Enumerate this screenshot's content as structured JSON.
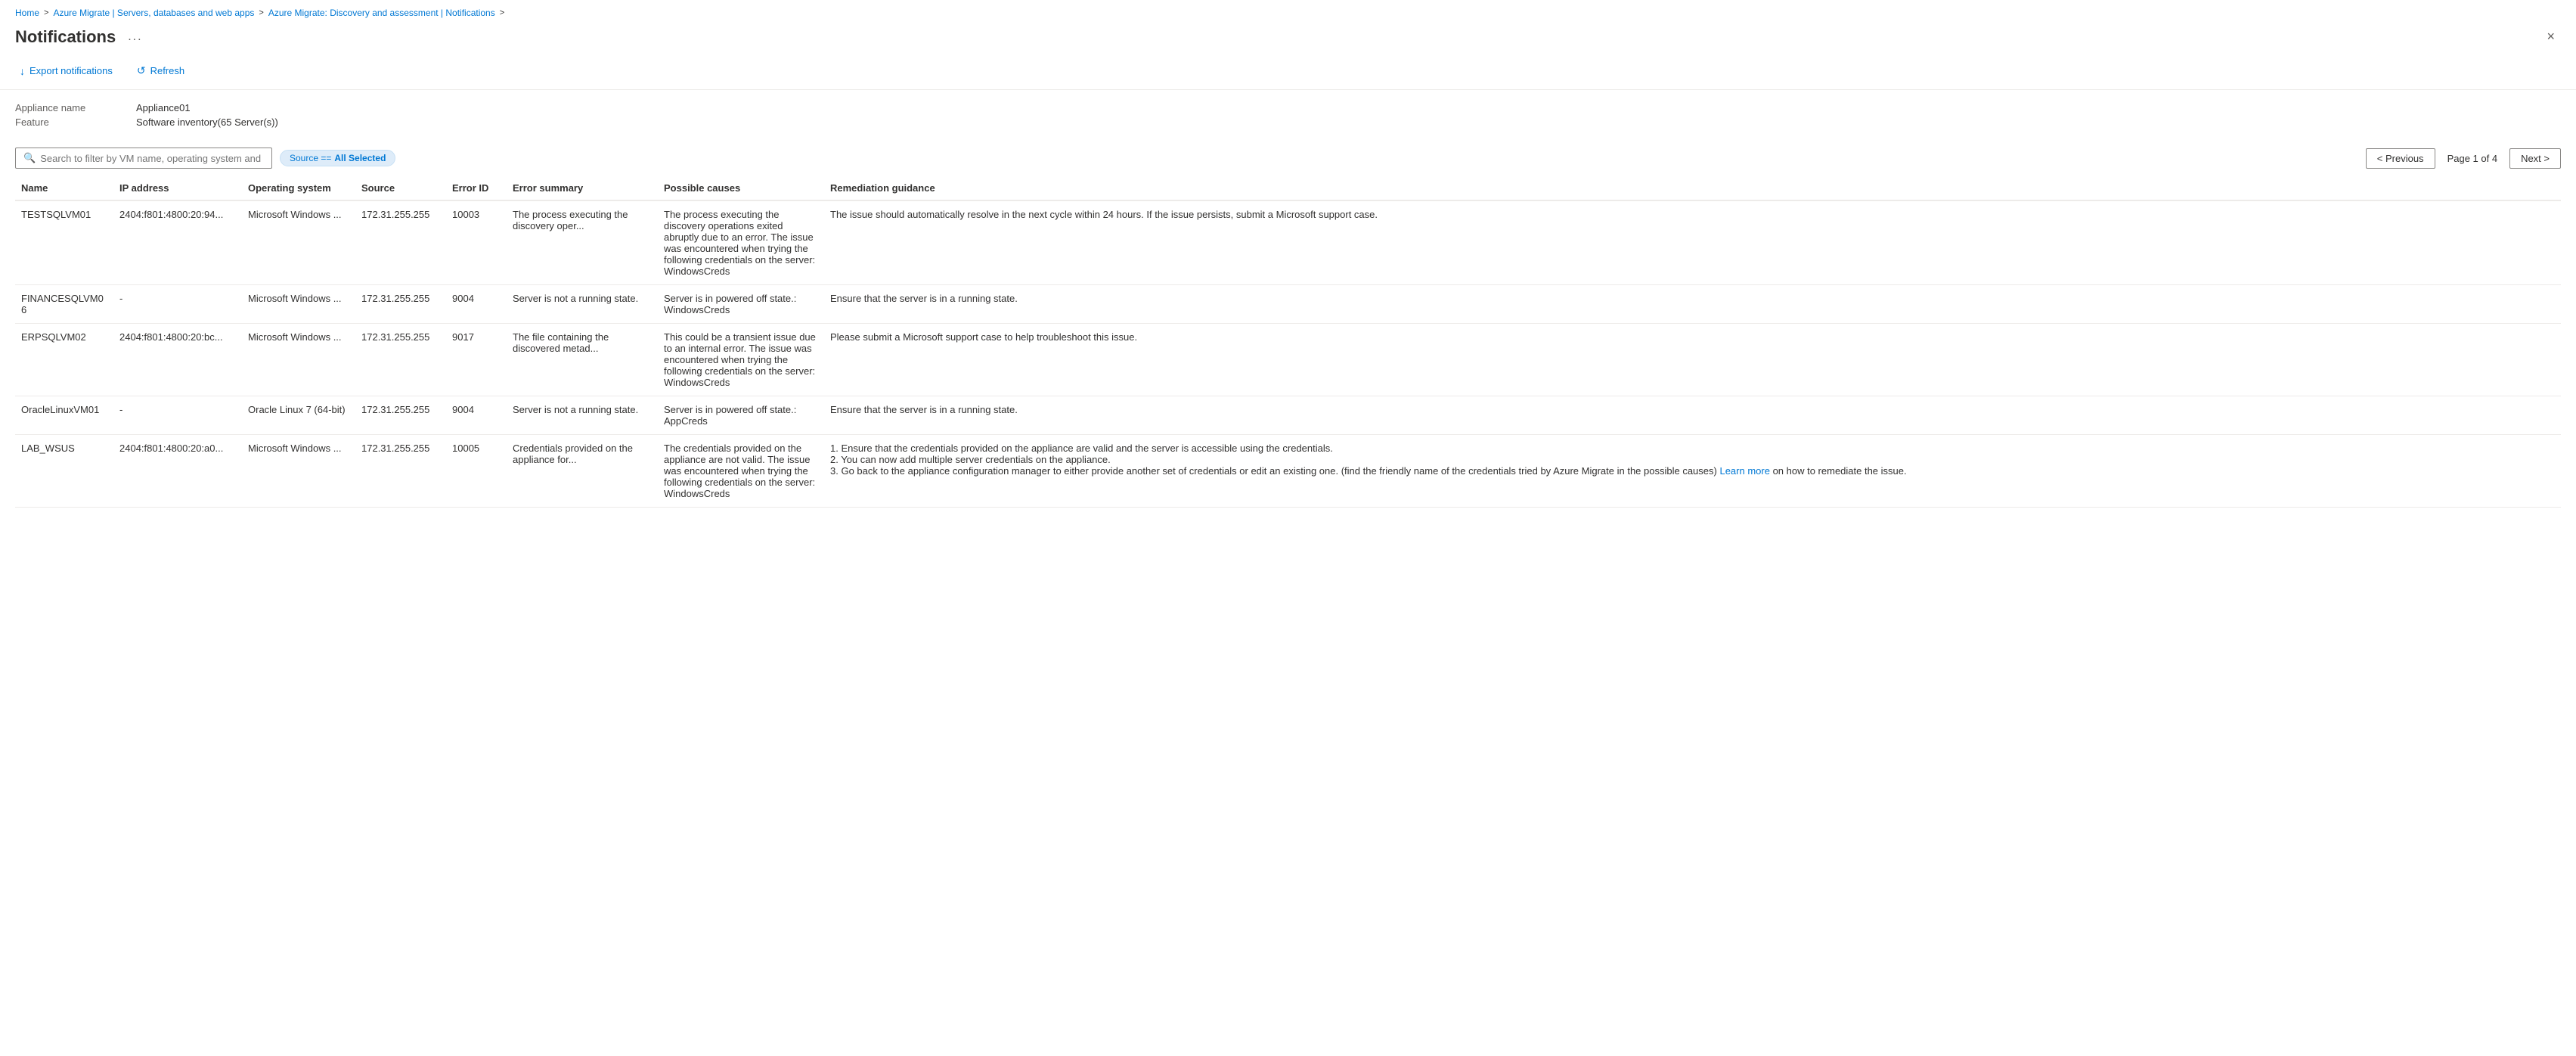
{
  "breadcrumb": {
    "items": [
      {
        "label": "Home",
        "link": true
      },
      {
        "label": "Azure Migrate | Servers, databases and web apps",
        "link": true
      },
      {
        "label": "Azure Migrate: Discovery and assessment | Notifications",
        "link": true
      }
    ]
  },
  "header": {
    "title": "Notifications",
    "ellipsis": "...",
    "close_label": "×"
  },
  "toolbar": {
    "export_label": "Export notifications",
    "refresh_label": "Refresh"
  },
  "meta": {
    "appliance_label": "Appliance name",
    "appliance_value": "Appliance01",
    "feature_label": "Feature",
    "feature_value": "Software inventory(65 Server(s))"
  },
  "filter": {
    "search_placeholder": "Search to filter by VM name, operating system and error ID",
    "source_tag_prefix": "Source ==",
    "source_tag_value": "All Selected",
    "previous_label": "< Previous",
    "page_info": "Page 1 of 4",
    "next_label": "Next >"
  },
  "table": {
    "columns": [
      {
        "key": "name",
        "label": "Name"
      },
      {
        "key": "ip",
        "label": "IP address"
      },
      {
        "key": "os",
        "label": "Operating system"
      },
      {
        "key": "source",
        "label": "Source"
      },
      {
        "key": "error_id",
        "label": "Error ID"
      },
      {
        "key": "error_summary",
        "label": "Error summary"
      },
      {
        "key": "possible_causes",
        "label": "Possible causes"
      },
      {
        "key": "remediation",
        "label": "Remediation guidance"
      }
    ],
    "rows": [
      {
        "name": "TESTSQLVM01",
        "ip": "2404:f801:4800:20:94...",
        "os": "Microsoft Windows ...",
        "source": "172.31.255.255",
        "error_id": "10003",
        "error_summary": "The process executing the discovery oper...",
        "possible_causes": "The process executing the discovery operations exited abruptly due to an error. The issue was encountered when trying the following credentials on the server: WindowsCreds",
        "remediation": "The issue should automatically resolve in the next cycle within 24 hours. If the issue persists, submit a Microsoft support case."
      },
      {
        "name": "FINANCESQLVM06",
        "ip": "-",
        "os": "Microsoft Windows ...",
        "source": "172.31.255.255",
        "error_id": "9004",
        "error_summary": "Server is not a running state.",
        "possible_causes": "Server is in powered off state.: WindowsCreds",
        "remediation": "Ensure that the server is in a running state."
      },
      {
        "name": "ERPSQLVM02",
        "ip": "2404:f801:4800:20:bc...",
        "os": "Microsoft Windows ...",
        "source": "172.31.255.255",
        "error_id": "9017",
        "error_summary": "The file containing the discovered metad...",
        "possible_causes": "This could be a transient issue due to an internal error. The issue was encountered when trying the following credentials on the server: WindowsCreds",
        "remediation": "Please submit a Microsoft support case to help troubleshoot this issue."
      },
      {
        "name": "OracleLinuxVM01",
        "ip": "-",
        "os": "Oracle Linux 7 (64-bit)",
        "source": "172.31.255.255",
        "error_id": "9004",
        "error_summary": "Server is not a running state.",
        "possible_causes": "Server is in powered off state.: AppCreds",
        "remediation": "Ensure that the server is in a running state."
      },
      {
        "name": "LAB_WSUS",
        "ip": "2404:f801:4800:20:a0...",
        "os": "Microsoft Windows ...",
        "source": "172.31.255.255",
        "error_id": "10005",
        "error_summary": "Credentials provided on the appliance for...",
        "possible_causes": "The credentials provided on the appliance are not valid. The issue was encountered when trying the following credentials on the server: WindowsCreds",
        "remediation_parts": [
          "1. Ensure that the credentials provided on the appliance are valid and the server is accessible using the credentials.",
          "2. You can now add multiple server credentials on the appliance.",
          "3. Go back to the appliance configuration manager to either provide another set of credentials or edit an existing one. (find the friendly name of the credentials tried by Azure Migrate in the possible causes)",
          "learn_more",
          " on how to remediate the issue."
        ],
        "remediation": "1. Ensure that the credentials provided on the appliance are valid and the server is accessible using the credentials.\n2. You can now add multiple server credentials on the appliance.\n3. Go back to the appliance configuration manager to either provide another set of credentials or edit an existing one. (find the friendly name of the credentials tried by Azure Migrate in the possible causes)\nLearn more on how to remediate the issue.",
        "has_learn_more": true,
        "learn_more_label": "Learn more"
      }
    ]
  }
}
